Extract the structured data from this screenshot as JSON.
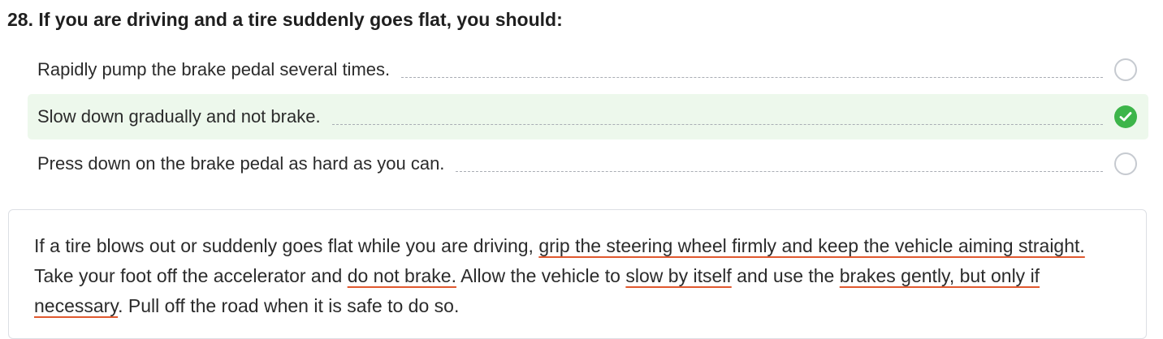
{
  "question": {
    "title": "28. If you are driving and a tire suddenly goes flat, you should:"
  },
  "options": [
    {
      "label": "Rapidly pump the brake pedal several times.",
      "selected": false
    },
    {
      "label": "Slow down gradually and not brake.",
      "selected": true
    },
    {
      "label": "Press down on the brake pedal as hard as you can.",
      "selected": false
    }
  ],
  "explanation": {
    "segments": [
      {
        "text": "If a tire blows out or suddenly goes flat while you are driving, ",
        "highlight": false
      },
      {
        "text": "grip the steering wheel firmly and keep the vehicle aiming straight.",
        "highlight": true
      },
      {
        "text": " Take your foot off the accelerator and ",
        "highlight": false
      },
      {
        "text": "do not brake.",
        "highlight": true
      },
      {
        "text": " Allow the vehicle to ",
        "highlight": false
      },
      {
        "text": "slow by itself",
        "highlight": true
      },
      {
        "text": " and use the ",
        "highlight": false
      },
      {
        "text": "brakes gently, but only if necessary",
        "highlight": true
      },
      {
        "text": ". Pull off the road when it is safe to do so.",
        "highlight": false
      }
    ]
  },
  "icons": {
    "selected_radio": "checkmark-circle-icon",
    "unselected_radio": "empty-circle-icon"
  },
  "colors": {
    "selected_background": "#edf8ec",
    "check_green": "#3db54a",
    "underline_orange": "#e0582e",
    "radio_border": "#c6cad0"
  }
}
